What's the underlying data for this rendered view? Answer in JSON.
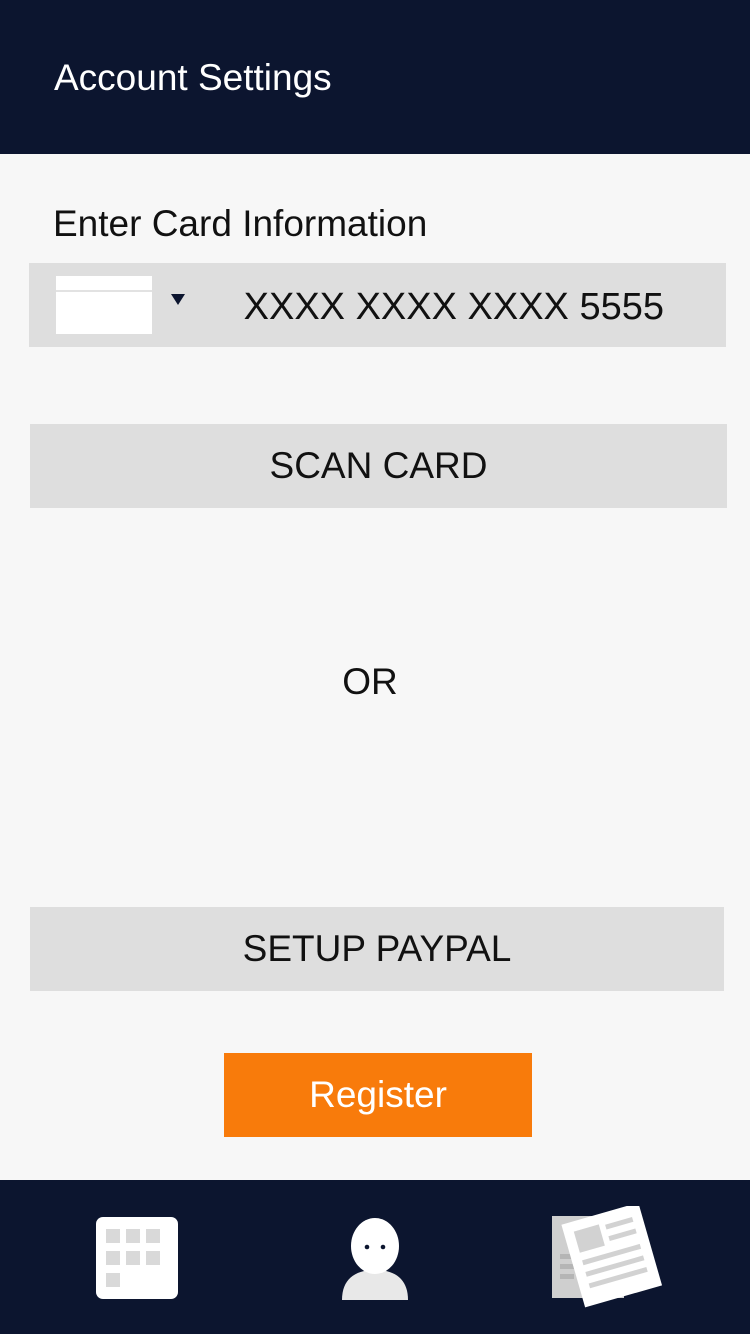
{
  "header": {
    "title": "Account Settings"
  },
  "card_entry": {
    "label": "Enter Card Information",
    "card_number": "XXXX XXXX XXXX 5555"
  },
  "actions": {
    "scan_card": "SCAN CARD",
    "or": "OR",
    "setup_paypal": "SETUP PAYPAL",
    "register": "Register"
  },
  "colors": {
    "navy": "#0c152f",
    "accent_orange": "#f87b0b",
    "button_grey": "#dedede",
    "background": "#f7f7f7"
  },
  "tabbar": {
    "tabs": [
      {
        "icon": "grid-icon"
      },
      {
        "icon": "profile-icon"
      },
      {
        "icon": "news-icon"
      }
    ]
  }
}
